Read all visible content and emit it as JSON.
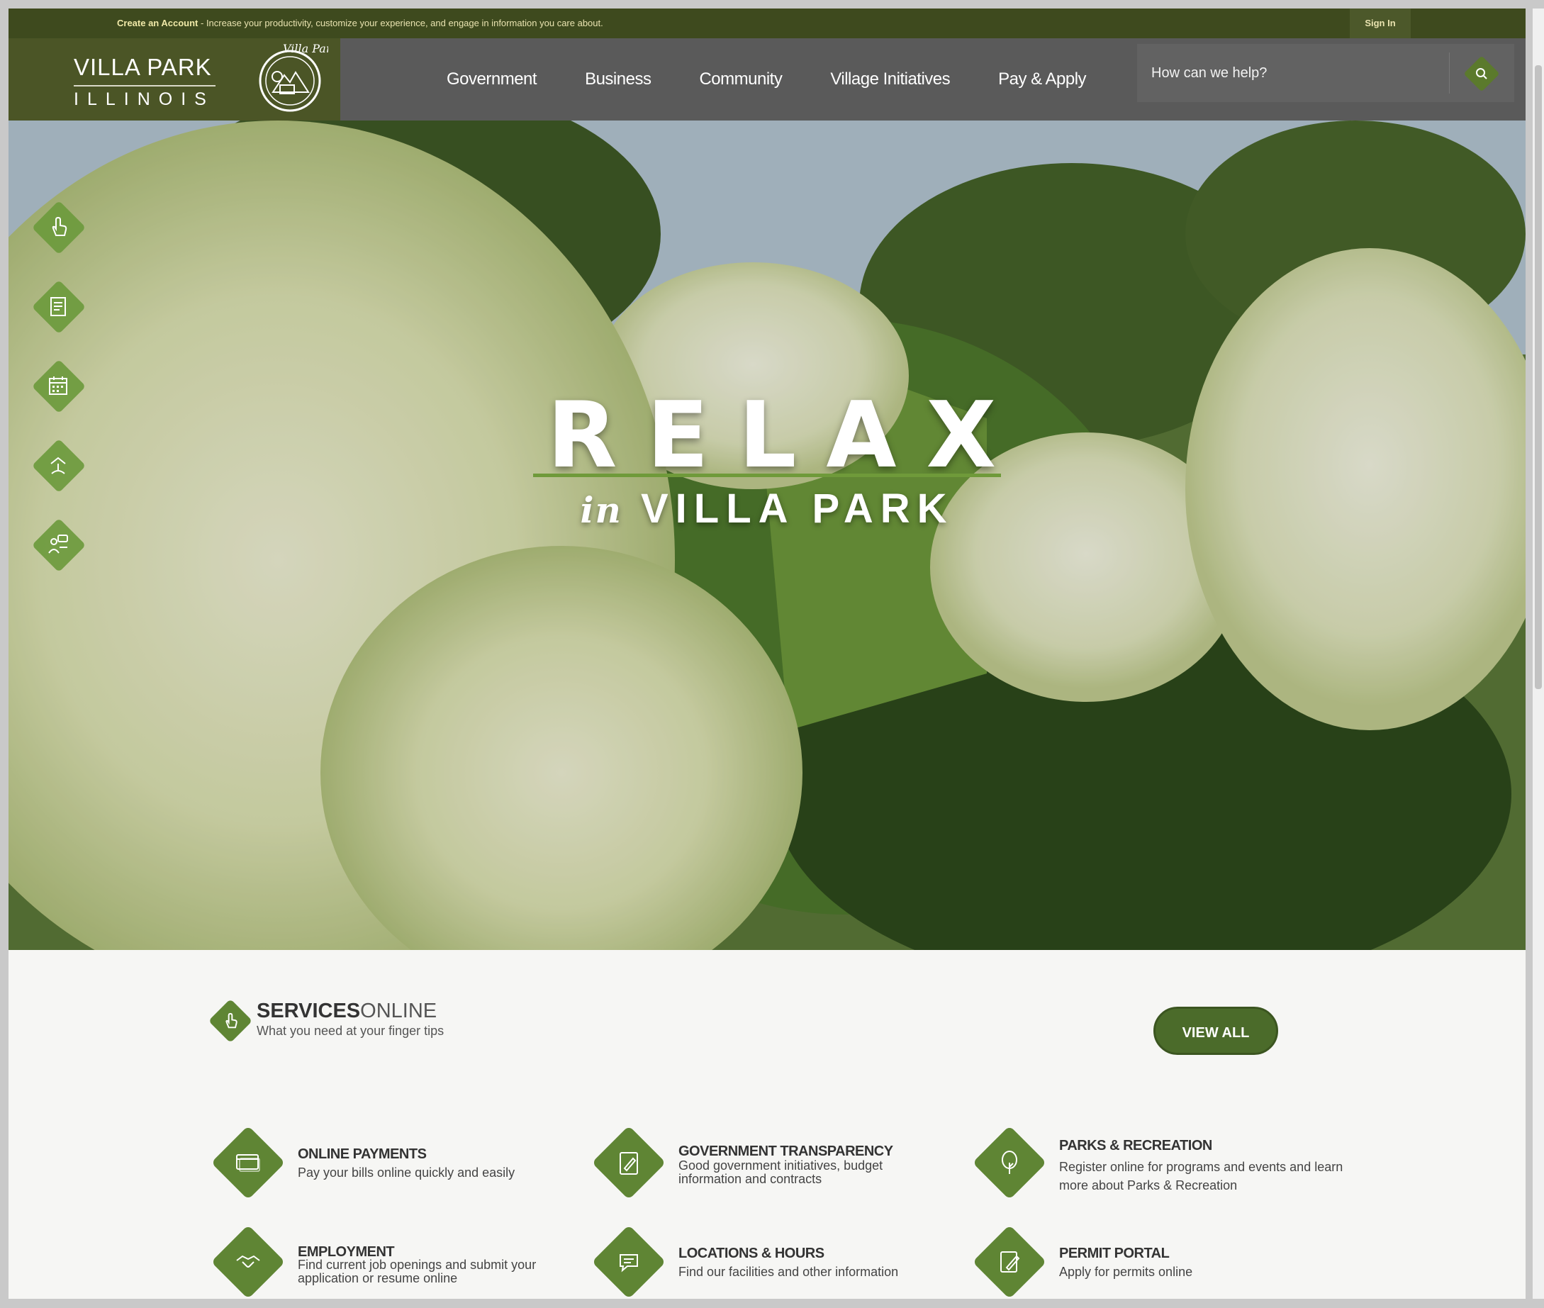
{
  "topbar": {
    "account_link": "Create an Account",
    "account_message": " - Increase your productivity, customize your experience, and engage in information you care about.",
    "signin": "Sign In"
  },
  "header": {
    "logo_name": "VILLA PARK",
    "logo_state": "ILLINOIS",
    "seal_text": "Villa Park",
    "nav": [
      "Government",
      "Business",
      "Community",
      "Village Initiatives",
      "Pay & Apply"
    ],
    "search_placeholder": "How can we help?"
  },
  "hero": {
    "title": "RELAX",
    "sub_in": "in",
    "sub_place": "VILLA PARK",
    "quick_links": [
      "hand-pointer-icon",
      "document-icon",
      "calendar-icon",
      "landmark-icon",
      "community-chat-icon"
    ]
  },
  "services": {
    "title_bold": "SERVICES",
    "title_light": "ONLINE",
    "subtitle": "What you need at your finger tips",
    "view_all": "VIEW ALL",
    "tiles": [
      {
        "title": "ONLINE PAYMENTS",
        "desc": "Pay your bills online quickly and easily",
        "icon": "credit-card-icon"
      },
      {
        "title": "GOVERNMENT TRANSPARENCY",
        "desc": "Good government initiatives, budget information and contracts",
        "icon": "clipboard-icon"
      },
      {
        "title": "PARKS & RECREATION",
        "desc": "Register online for programs and events and learn more about Parks & Recreation",
        "icon": "tree-icon"
      },
      {
        "title": "EMPLOYMENT",
        "desc": "Find current job openings and submit your application or resume online",
        "icon": "handshake-icon"
      },
      {
        "title": "LOCATIONS & HOURS",
        "desc": "Find our facilities and other information",
        "icon": "chat-bubble-icon"
      },
      {
        "title": "PERMIT PORTAL",
        "desc": "Apply for permits online",
        "icon": "permit-icon"
      }
    ]
  },
  "colors": {
    "brand_green": "#5f8534",
    "topbar_olive": "#3e4a1e",
    "header_gray": "#5a5a5a"
  }
}
